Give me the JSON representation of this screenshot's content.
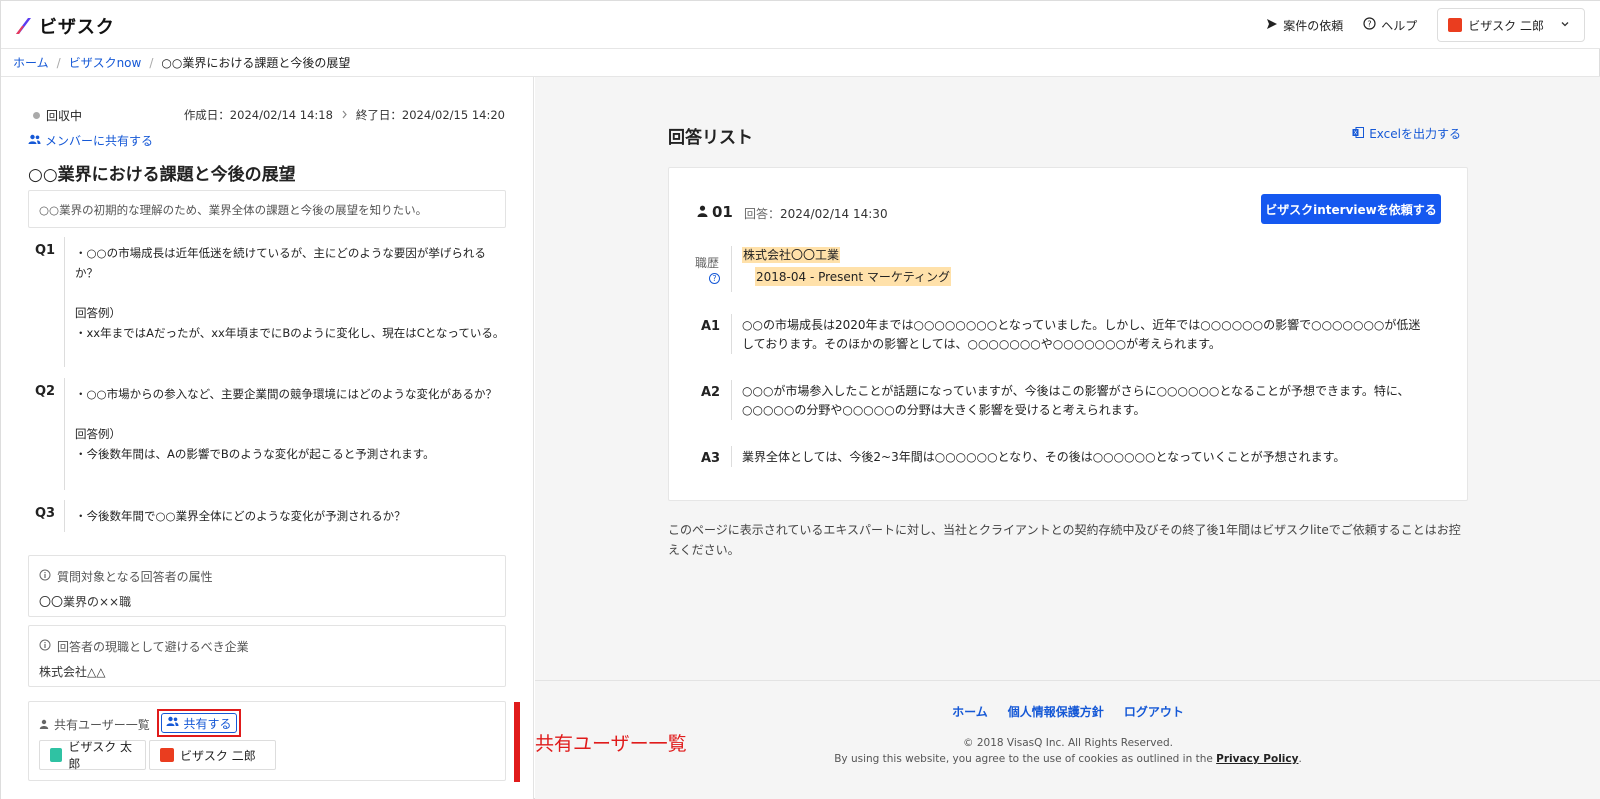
{
  "header": {
    "logo_text": "ビザスク",
    "nav": {
      "request_label": "案件の依頼",
      "help_label": "ヘルプ",
      "user_name": "ビザスク 二郎"
    }
  },
  "breadcrumb": {
    "home": "ホーム",
    "section": "ビザスクnow",
    "current": "○○業界における課題と今後の展望"
  },
  "project": {
    "status": "回収中",
    "created": "作成日：2024/02/14 14:18",
    "ended": "終了日：2024/02/15 14:20",
    "share_members_label": "メンバーに共有する",
    "title": "○○業界における課題と今後の展望",
    "description": "○○業界の初期的な理解のため、業界全体の課題と今後の展望を知りたい。",
    "questions": [
      {
        "label": "Q1",
        "text": "・○○の市場成長は近年低迷を続けているが、主にどのような要因が挙げられるか？\n\n回答例）\n・xx年まではAだったが、xx年頃までにBのように変化し、現在はCとなっている。"
      },
      {
        "label": "Q2",
        "text": "・○○市場からの参入など、主要企業間の競争環境にはどのような変化があるか？\n\n回答例）\n・今後数年間は、Aの影響でBのような変化が起こると予測されます。"
      },
      {
        "label": "Q3",
        "text": "・今後数年間で○○業界全体にどのような変化が予測されるか？"
      }
    ],
    "target_attr": {
      "heading": "質問対象となる回答者の属性",
      "value": "〇〇業界の××職"
    },
    "avoid_companies": {
      "heading": "回答者の現職として避けるべき企業",
      "value": "株式会社△△"
    },
    "shared_users": {
      "heading": "共有ユーザー一覧",
      "share_button": "共有する",
      "users": [
        "ビザスク 太郎",
        "ビザスク 二郎"
      ]
    }
  },
  "annotation": {
    "label": "共有ユーザー一覧",
    "color": "#e01b1b"
  },
  "answers": {
    "title": "回答リスト",
    "excel_label": "Excelを出力する",
    "card": {
      "id": "01",
      "date_key": "回答：",
      "date_value": "2024/02/14 14:30",
      "request_button": "ビザスクinterviewを依頼する",
      "career_label": "職歴",
      "company": "株式会社〇〇工業",
      "career_line": "2018-04 - Present マーケティング",
      "items": [
        {
          "label": "A1",
          "text": "○○の市場成長は2020年までは○○○○○○○○となっていました。しかし、近年では○○○○○○の影響で○○○○○○○が低迷しております。そのほかの影響としては、○○○○○○○や○○○○○○○が考えられます。"
        },
        {
          "label": "A2",
          "text": "○○○が市場参入したことが話題になっていますが、今後はこの影響がさらに○○○○○○となることが予想できます。特に、○○○○○の分野や○○○○○の分野は大きく影響を受けると考えられます。"
        },
        {
          "label": "A3",
          "text": "業界全体としては、今後2~3年間は○○○○○○となり、その後は○○○○○○となっていくことが予想されます。"
        }
      ]
    },
    "note": "このページに表示されているエキスパートに対し、当社とクライアントとの契約存続中及びその終了後1年間はビザスクliteでご依頼することはお控えください。"
  },
  "footer": {
    "links": [
      "ホーム",
      "個人情報保護方針",
      "ログアウト"
    ],
    "copyright": "© 2018 VisasQ Inc. All Rights Reserved.",
    "cookie_text": "By using this website, you agree to the use of cookies as outlined in the ",
    "privacy_link": "Privacy Policy",
    "cookie_end": "."
  },
  "colors": {
    "accent": "#1558d6",
    "primary_button": "#1558f0",
    "highlight": "#ffe1aa",
    "avatar_red": "#ea3d1f",
    "avatar_teal": "#2fc2a3"
  },
  "icons": [
    "send-icon",
    "help-circle-icon",
    "chevron-down-icon",
    "people-icon",
    "person-icon",
    "info-icon",
    "excel-icon",
    "chevron-right-icon"
  ]
}
